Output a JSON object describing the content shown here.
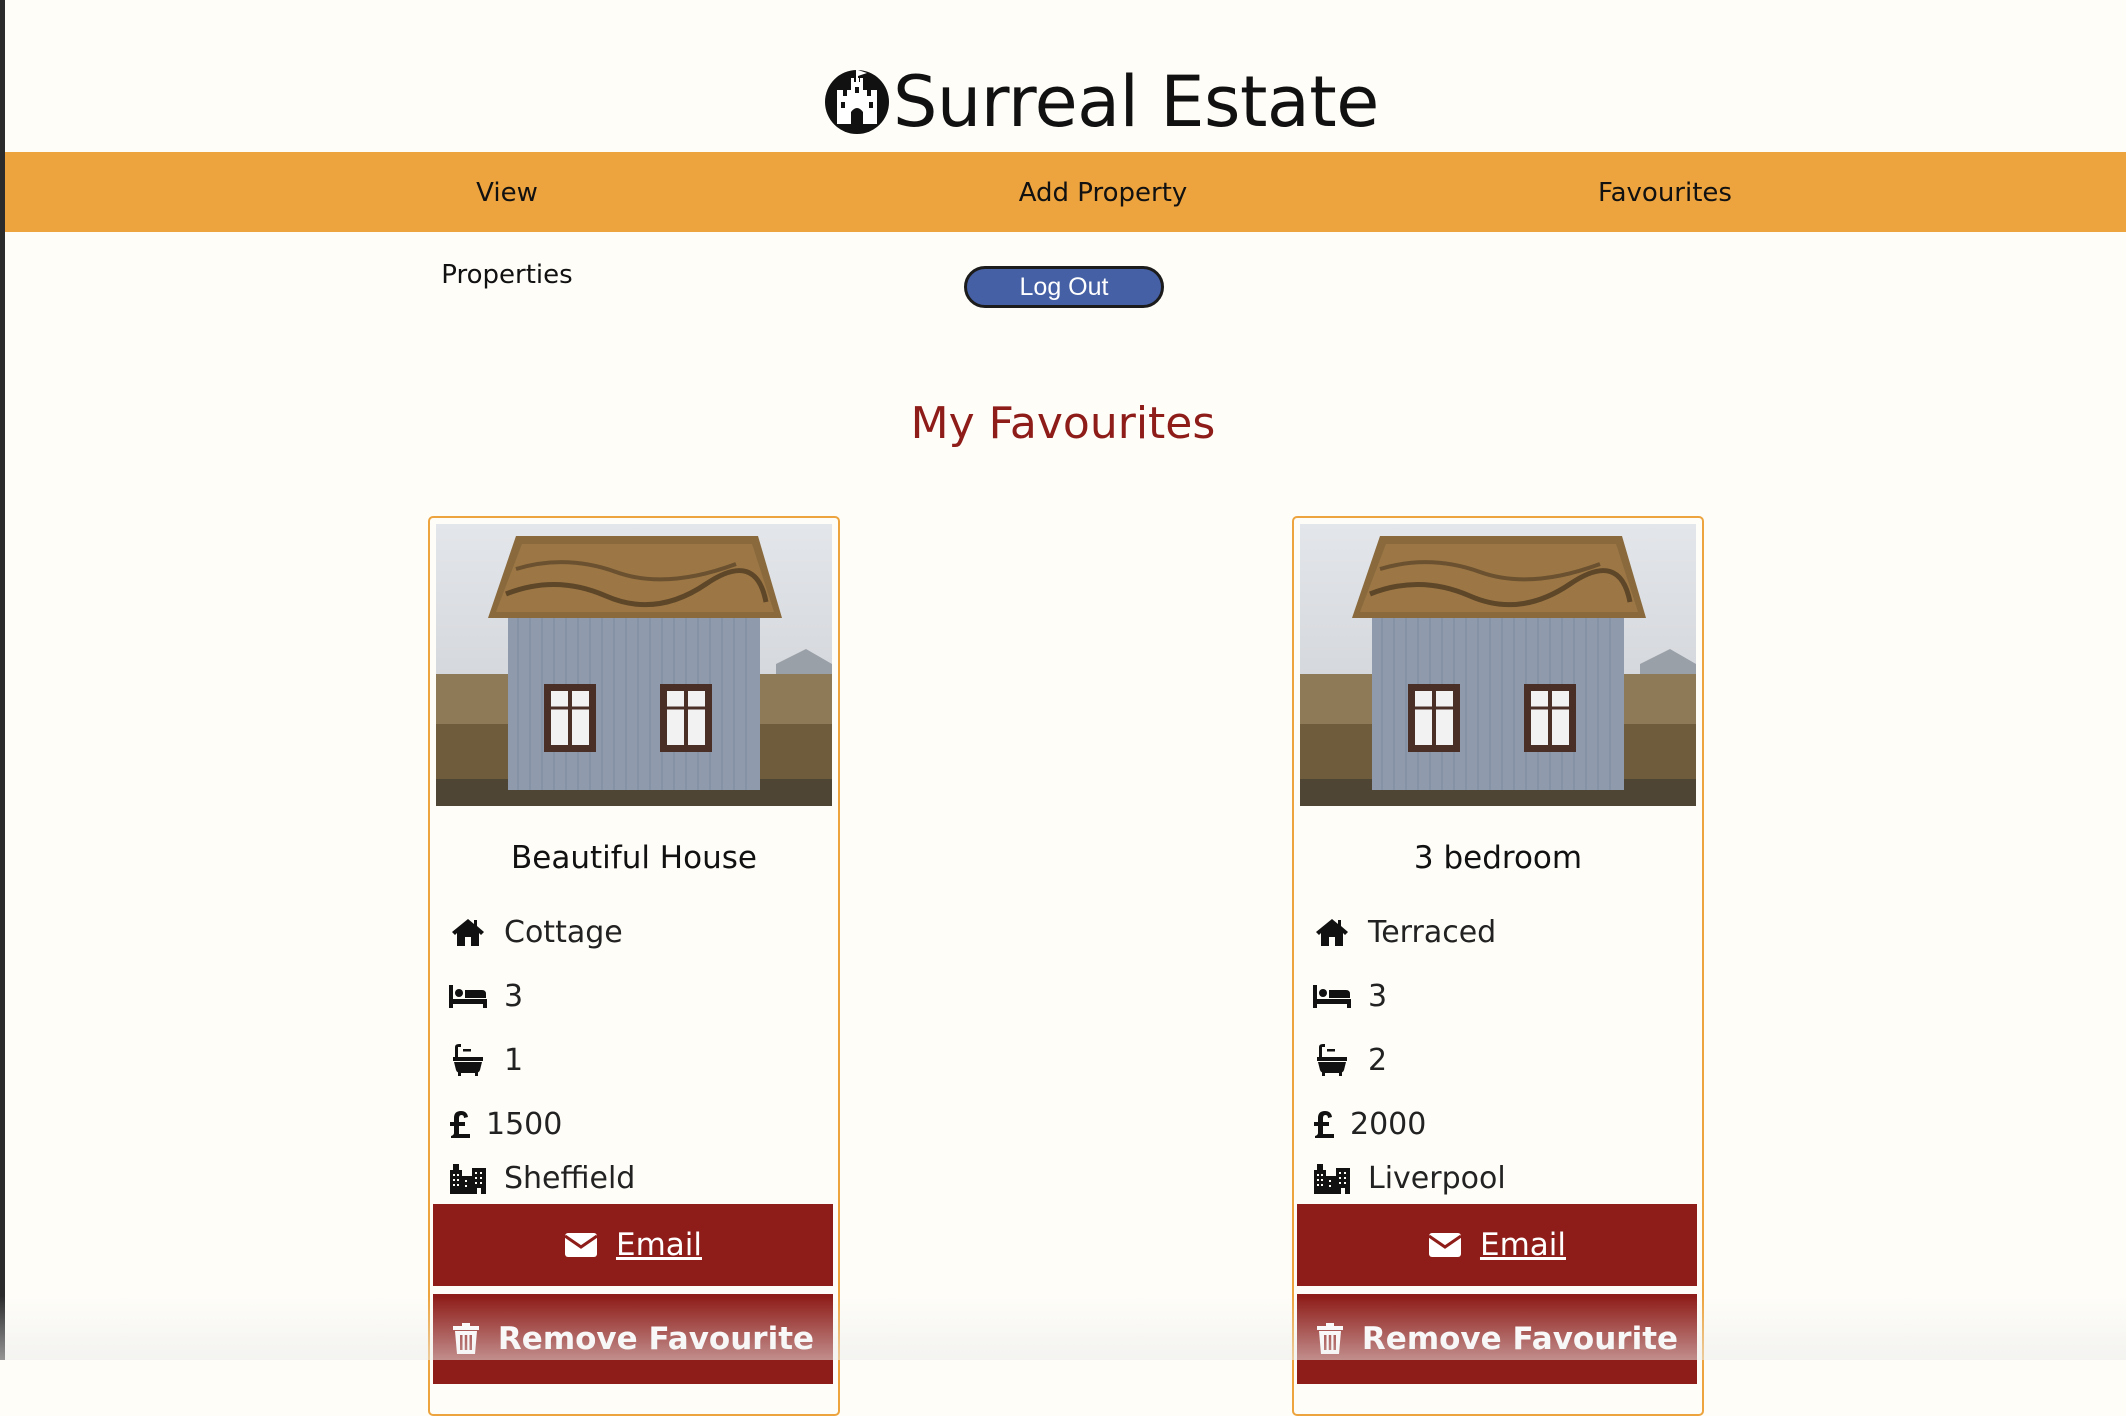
{
  "site": {
    "title": "Surreal Estate",
    "logo_icon": "castle-icon"
  },
  "nav": {
    "items": [
      {
        "label": "View Properties"
      },
      {
        "label": "Add Property"
      },
      {
        "label": "Favourites"
      }
    ]
  },
  "auth": {
    "logout_label": "Log Out"
  },
  "page": {
    "heading": "My Favourites"
  },
  "favourites": [
    {
      "title": "Beautiful House",
      "type": "Cottage",
      "bedrooms": "3",
      "bathrooms": "1",
      "price": "1500",
      "city": "Sheffield",
      "email_label": "Email",
      "remove_label": "Remove Favourite"
    },
    {
      "title": "3 bedroom",
      "type": "Terraced",
      "bedrooms": "3",
      "bathrooms": "2",
      "price": "2000",
      "city": "Liverpool",
      "email_label": "Email",
      "remove_label": "Remove Favourite"
    }
  ],
  "icons": {
    "type": "home-icon",
    "bedrooms": "bed-icon",
    "bathrooms": "bath-icon",
    "price": "pound-icon",
    "city": "city-icon",
    "email": "envelope-icon",
    "remove": "trash-icon"
  },
  "colors": {
    "background": "#fefdf8",
    "nav_bar": "#eda43e",
    "heading": "#8e1c18",
    "action_button": "#8e1c18",
    "logout_button": "#4560a5",
    "card_border": "#eda43e"
  }
}
